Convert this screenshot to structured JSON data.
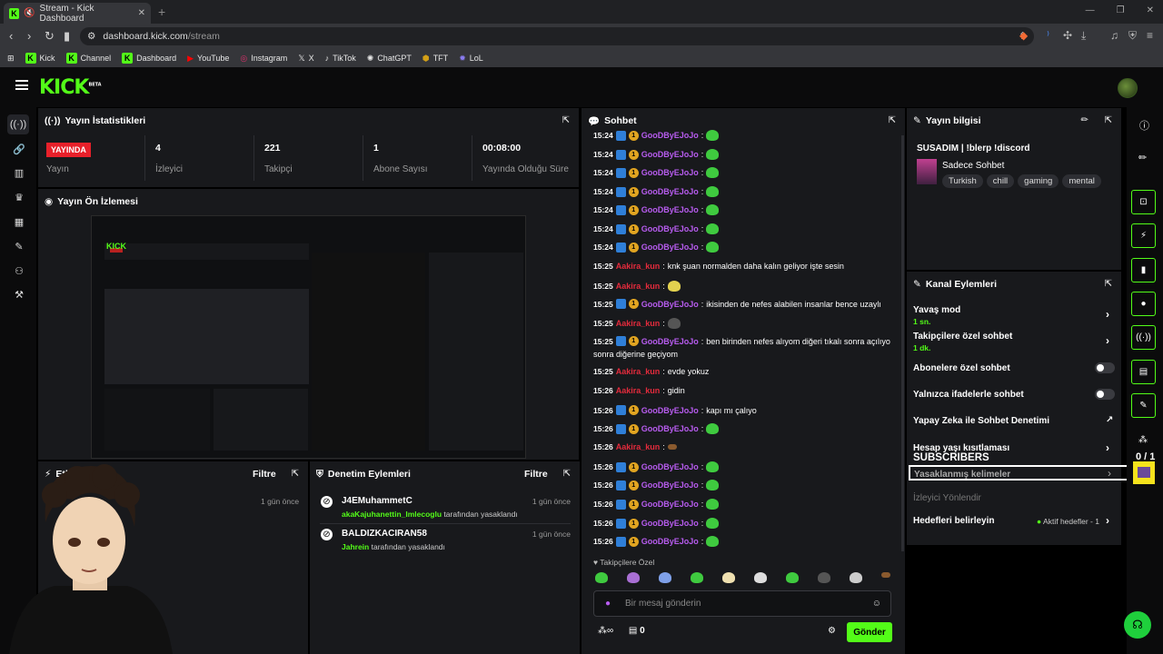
{
  "browser": {
    "tab_title": "Stream - Kick Dashboard",
    "url_host": "dashboard.kick.com",
    "url_path": "/stream",
    "bookmarks": [
      "Kick",
      "Channel",
      "Dashboard",
      "YouTube",
      "Instagram",
      "X",
      "TikTok",
      "ChatGPT",
      "TFT",
      "LoL"
    ]
  },
  "stats": {
    "title": "Yayın İstatistikleri",
    "badge": "YAYINDA",
    "items": [
      {
        "value": "",
        "label": "Yayın"
      },
      {
        "value": "4",
        "label": "İzleyici"
      },
      {
        "value": "221",
        "label": "Takipçi"
      },
      {
        "value": "1",
        "label": "Abone Sayısı"
      },
      {
        "value": "00:08:00",
        "label": "Yayında Olduğu Süre"
      }
    ]
  },
  "preview": {
    "title": "Yayın Ön İzlemesi"
  },
  "events": {
    "title": "Etk",
    "filter": "Filtre",
    "ago": "1 gün önce"
  },
  "moderation": {
    "title": "Denetim Eylemleri",
    "filter": "Filtre",
    "items": [
      {
        "name": "J4EMuhammetC",
        "by": "akaKajuhanettin_Imlecoglu",
        "suffix": " tarafından yasaklandı",
        "ago": "1 gün önce"
      },
      {
        "name": "BALDIZKACIRAN58",
        "by": "Jahrein",
        "suffix": " tarafından yasaklandı",
        "ago": "1 gün önce"
      }
    ]
  },
  "chat": {
    "title": "Sohbet",
    "messages": [
      {
        "t": "15:24",
        "u": "GooDByEJoJo",
        "c": "p",
        "text": "",
        "emo": "green"
      },
      {
        "t": "15:24",
        "u": "GooDByEJoJo",
        "c": "p",
        "text": "",
        "emo": "green"
      },
      {
        "t": "15:24",
        "u": "GooDByEJoJo",
        "c": "p",
        "text": "",
        "emo": "green"
      },
      {
        "t": "15:24",
        "u": "GooDByEJoJo",
        "c": "p",
        "text": "",
        "emo": "green"
      },
      {
        "t": "15:24",
        "u": "GooDByEJoJo",
        "c": "p",
        "text": "",
        "emo": "green"
      },
      {
        "t": "15:24",
        "u": "GooDByEJoJo",
        "c": "p",
        "text": "",
        "emo": "green"
      },
      {
        "t": "15:24",
        "u": "GooDByEJoJo",
        "c": "p",
        "text": "",
        "emo": "green"
      },
      {
        "t": "15:25",
        "u": "Aakira_kun",
        "c": "r",
        "text": "knk şuan normalden daha kalın geliyor işte sesin",
        "emo": ""
      },
      {
        "t": "15:25",
        "u": "Aakira_kun",
        "c": "r",
        "text": "",
        "emo": "yellow"
      },
      {
        "t": "15:25",
        "u": "GooDByEJoJo",
        "c": "p",
        "text": "ikisinden de nefes alabilen insanlar bence uzaylı",
        "emo": ""
      },
      {
        "t": "15:25",
        "u": "Aakira_kun",
        "c": "r",
        "text": "",
        "emo": "grey"
      },
      {
        "t": "15:25",
        "u": "GooDByEJoJo",
        "c": "p",
        "text": "ben birinden nefes alıyom diğeri tıkalı sonra açılıyo",
        "text2": "sonra diğerine geçiyom",
        "emo": ""
      },
      {
        "t": "15:25",
        "u": "Aakira_kun",
        "c": "r",
        "text": "evde yokuz",
        "emo": ""
      },
      {
        "t": "15:26",
        "u": "Aakira_kun",
        "c": "r",
        "text": "gidin",
        "emo": ""
      },
      {
        "t": "15:26",
        "u": "GooDByEJoJo",
        "c": "p",
        "text": "kapı mı çalıyo",
        "emo": ""
      },
      {
        "t": "15:26",
        "u": "GooDByEJoJo",
        "c": "p",
        "text": "",
        "emo": "green"
      },
      {
        "t": "15:26",
        "u": "Aakira_kun",
        "c": "r",
        "text": "",
        "emo": "brown"
      },
      {
        "t": "15:26",
        "u": "GooDByEJoJo",
        "c": "p",
        "text": "",
        "emo": "green"
      },
      {
        "t": "15:26",
        "u": "GooDByEJoJo",
        "c": "p",
        "text": "",
        "emo": "green"
      },
      {
        "t": "15:26",
        "u": "GooDByEJoJo",
        "c": "p",
        "text": "",
        "emo": "green"
      },
      {
        "t": "15:26",
        "u": "GooDByEJoJo",
        "c": "p",
        "text": "",
        "emo": "green"
      },
      {
        "t": "15:26",
        "u": "GooDByEJoJo",
        "c": "p",
        "text": "",
        "emo": "green"
      }
    ],
    "followers_only": "Takipçilere Özel",
    "placeholder": "Bir mesaj gönderin",
    "points": "0",
    "send": "Gönder"
  },
  "info": {
    "title": "Yayın bilgisi",
    "stream_title": "SUSADIM | !blerp !discord",
    "category": "Sadece Sohbet",
    "tags": [
      "Turkish",
      "chill",
      "gaming",
      "mental"
    ]
  },
  "actions": {
    "title": "Kanal Eylemleri",
    "slow": {
      "label": "Yavaş mod",
      "sub": "1 sn."
    },
    "followers": {
      "label": "Takipçilere özel sohbet",
      "sub": "1 dk."
    },
    "subs": "Abonelere özel sohbet",
    "emotes": "Yalnızca ifadelerle sohbet",
    "ai": "Yapay Zeka ile Sohbet Denetimi",
    "age": "Hesap yaşı kısıtlaması",
    "banned": "Yasaklanmış kelimeler",
    "redirect": "İzleyici Yönlendir",
    "goals": "Hedefleri belirleyin",
    "goals_active": "Aktif hedefler - 1"
  },
  "overlay": {
    "subscribers": "SUBSCRIBERS",
    "count": "0 / 1"
  }
}
